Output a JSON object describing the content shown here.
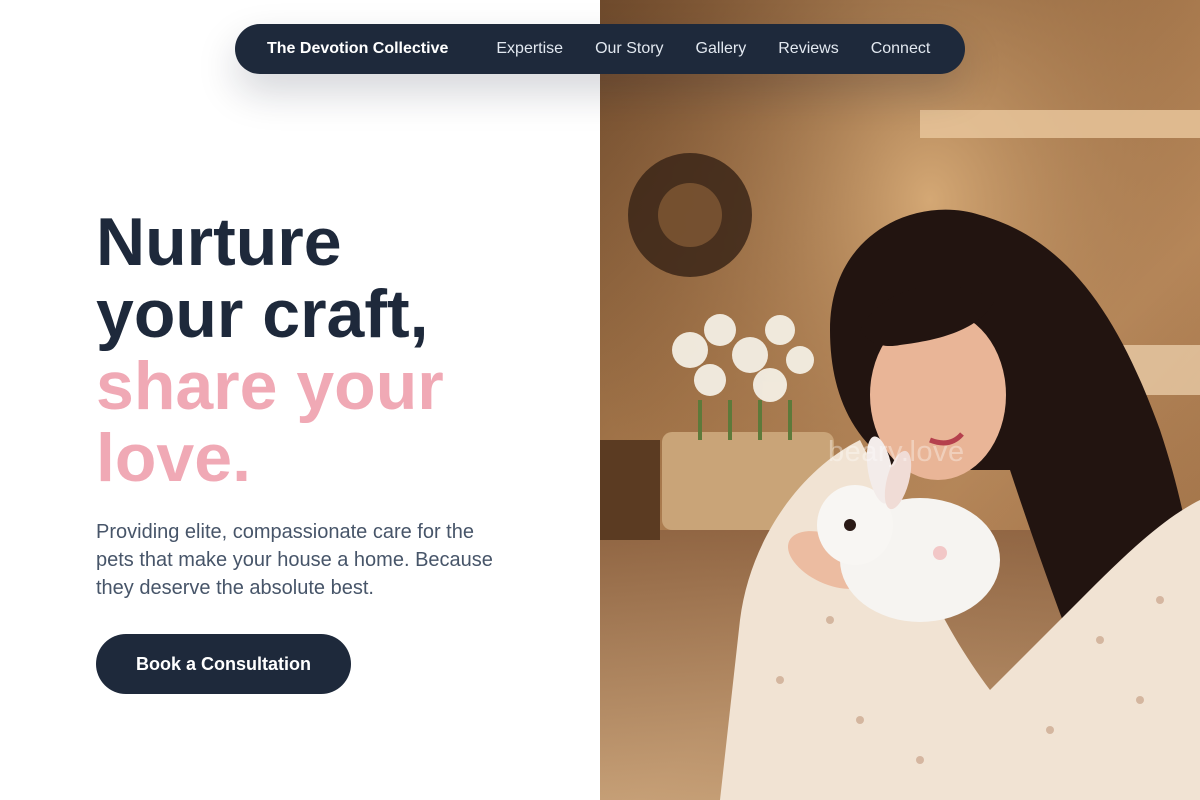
{
  "nav": {
    "brand": "The Devotion Collective",
    "links": [
      "Expertise",
      "Our Story",
      "Gallery",
      "Reviews",
      "Connect"
    ]
  },
  "hero": {
    "headline_line1": "Nurture",
    "headline_line2": "your craft,",
    "headline_line3": "share your",
    "headline_line4": "love.",
    "subtext": "Providing elite, compassionate care for the pets that make your house a home. Because they deserve the absolute best.",
    "cta_label": "Book a Consultation"
  },
  "photo": {
    "watermark": "beary.love"
  },
  "colors": {
    "navy": "#1e293b",
    "pink": "#f0a9b5",
    "body_text": "#475569"
  }
}
